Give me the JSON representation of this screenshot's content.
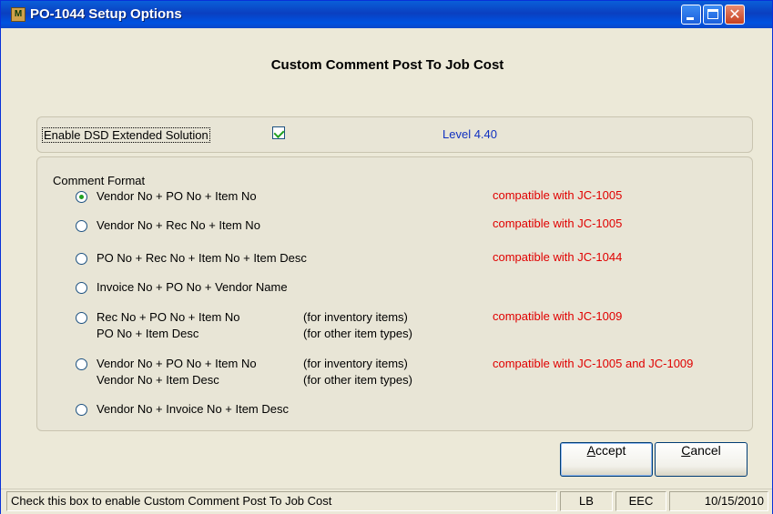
{
  "window": {
    "title": "PO-1044 Setup Options",
    "icon": "app-icon"
  },
  "heading": "Custom Comment Post To Job Cost",
  "enable": {
    "label": "Enable DSD Extended Solution",
    "checked": true,
    "level": "Level  4.40"
  },
  "format": {
    "label": "Comment Format",
    "options": [
      {
        "text": "Vendor No + PO No + Item No",
        "selected": true,
        "compat": "compatible with JC-1005"
      },
      {
        "text": "Vendor No + Rec No + Item No",
        "selected": false,
        "compat": "compatible with JC-1005"
      },
      {
        "text": "PO No + Rec No + Item No + Item Desc",
        "selected": false,
        "compat": "compatible with JC-1044"
      },
      {
        "text": "Invoice No + PO No + Vendor Name",
        "selected": false
      },
      {
        "text": "Rec No + PO No + Item No",
        "text2": "PO No + Item Desc",
        "note1": "(for inventory items)",
        "note2": "(for other item types)",
        "selected": false,
        "compat": "compatible with JC-1009"
      },
      {
        "text": "Vendor No + PO No + Item No",
        "text2": "Vendor No + Item Desc",
        "note1": "(for inventory items)",
        "note2": "(for other item types)",
        "selected": false,
        "compat": "compatible with JC-1005 and JC-1009"
      },
      {
        "text": "Vendor No + Invoice No + Item Desc",
        "selected": false
      }
    ]
  },
  "buttons": {
    "accept": {
      "underline": "A",
      "rest": "ccept"
    },
    "cancel": {
      "underline": "C",
      "rest": "ancel"
    }
  },
  "status": {
    "message": "Check this box to enable Custom Comment Post To Job Cost",
    "user": "LB",
    "company": "EEC",
    "date": "10/15/2010"
  }
}
